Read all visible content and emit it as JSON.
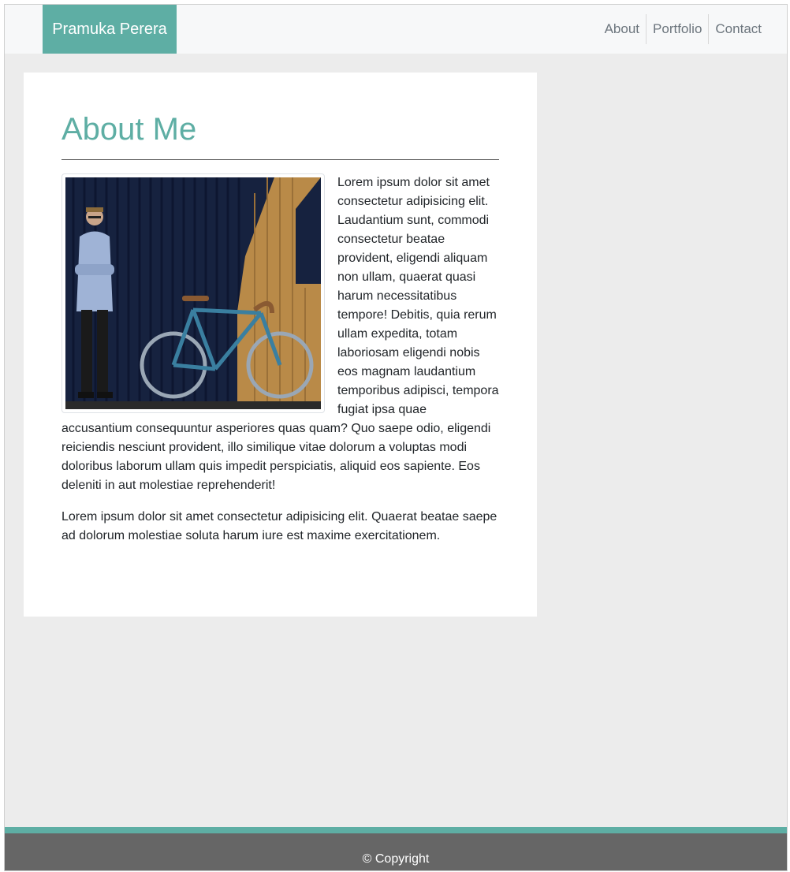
{
  "navbar": {
    "brand": "Pramuka Perera",
    "links": [
      "About",
      "Portfolio",
      "Contact"
    ]
  },
  "about": {
    "title": "About Me",
    "paragraph_1": "Lorem ipsum dolor sit amet consectetur adipisicing elit. Laudantium sunt, commodi consectetur beatae provident, eligendi aliquam non ullam, quaerat quasi harum necessitatibus tempore! Debitis, quia rerum ullam expedita, totam laboriosam eligendi nobis eos magnam laudantium temporibus adipisci, tempora fugiat ipsa quae accusantium consequuntur asperiores quas quam? Quo saepe odio, eligendi reiciendis nesciunt provident, illo similique vitae dolorum a voluptas modi doloribus laborum ullam quis impedit perspiciatis, aliquid eos sapiente. Eos deleniti in aut molestiae reprehenderit!",
    "paragraph_2": "Lorem ipsum dolor sit amet consectetur adipisicing elit. Quaerat beatae saepe ad dolorum molestiae soluta harum iure est maxime exercitationem."
  },
  "footer": {
    "copyright": "© Copyright"
  },
  "colors": {
    "accent": "#5eaea4",
    "footer_bg": "#666666",
    "page_bg": "#ececec"
  }
}
